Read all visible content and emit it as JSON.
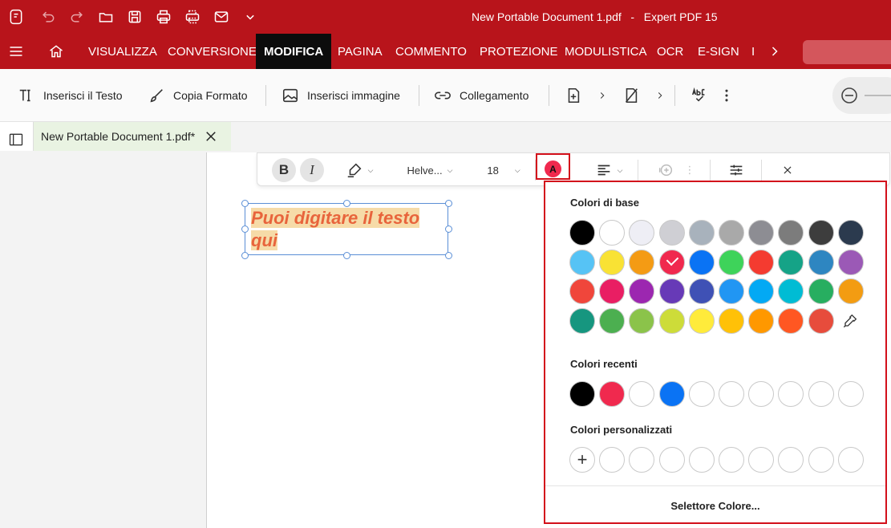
{
  "window": {
    "title": "New Portable Document 1.pdf   -   Expert PDF 15"
  },
  "titlebar_icons": [
    "app-logo-icon",
    "undo-icon",
    "redo-icon",
    "open-folder-icon",
    "save-icon",
    "print-icon",
    "scan-print-icon",
    "mail-icon",
    "chevron-down-icon"
  ],
  "ribbon": {
    "tabs": [
      {
        "label": "VISUALIZZA"
      },
      {
        "label": "CONVERSIONE"
      },
      {
        "label": "MODIFICA",
        "active": true
      },
      {
        "label": "PAGINA"
      },
      {
        "label": "COMMENTO"
      },
      {
        "label": "PROTEZIONE"
      },
      {
        "label": "MODULISTICA"
      },
      {
        "label": "OCR"
      },
      {
        "label": "E-SIGN"
      },
      {
        "label": "I"
      }
    ]
  },
  "toolbar": {
    "insert_text": "Inserisci il Testo",
    "copy_format": "Copia Formato",
    "insert_image": "Inserisci immagine",
    "link": "Collegamento"
  },
  "doc_tab": {
    "label": "New Portable Document 1.pdf*"
  },
  "format_bar": {
    "bold": "B",
    "italic": "I",
    "font": "Helve...",
    "size": "18",
    "color_letter": "A"
  },
  "textbox": {
    "line1": "Puoi digitare il testo",
    "line2": "qui",
    "color": "#e8643c"
  },
  "color_popup": {
    "basic_title": "Colori di base",
    "recent_title": "Colori recenti",
    "custom_title": "Colori personalizzati",
    "picker_label": "Selettore Colore...",
    "selected_color": "#f0294e",
    "basic_colors": [
      [
        "#000000",
        "#ffffff",
        "#eeeef5",
        "#cfcfd4",
        "#a8b2bc",
        "#a9a9a9",
        "#8d8d93",
        "#7c7c7c",
        "#3d3d3d",
        "#2b3a4e"
      ],
      [
        "#56c3f5",
        "#f9e234",
        "#f49b14",
        "#f0294e",
        "#0a73f4",
        "#3ed35a",
        "#f43b30",
        "#15a387",
        "#2e86c1",
        "#9b59b6"
      ],
      [
        "#f0463b",
        "#e91e63",
        "#9c27b0",
        "#673ab7",
        "#3f51b5",
        "#2196f3",
        "#03a9f4",
        "#00bcd4",
        "#27ae60",
        "#f39c12"
      ],
      [
        "#16967f",
        "#4caf50",
        "#8bc34a",
        "#cddc39",
        "#ffeb3b",
        "#ffc107",
        "#ff9800",
        "#ff5722",
        "#e74c3c"
      ]
    ],
    "recent_colors": [
      "#000000",
      "#f0294e",
      "#ffffff",
      "#0a73f4",
      "#ffffff",
      "#ffffff",
      "#ffffff",
      "#ffffff",
      "#ffffff",
      "#ffffff"
    ],
    "custom_colors": [
      "#ffffff",
      "#ffffff",
      "#ffffff",
      "#ffffff",
      "#ffffff",
      "#ffffff",
      "#ffffff",
      "#ffffff",
      "#ffffff"
    ]
  }
}
